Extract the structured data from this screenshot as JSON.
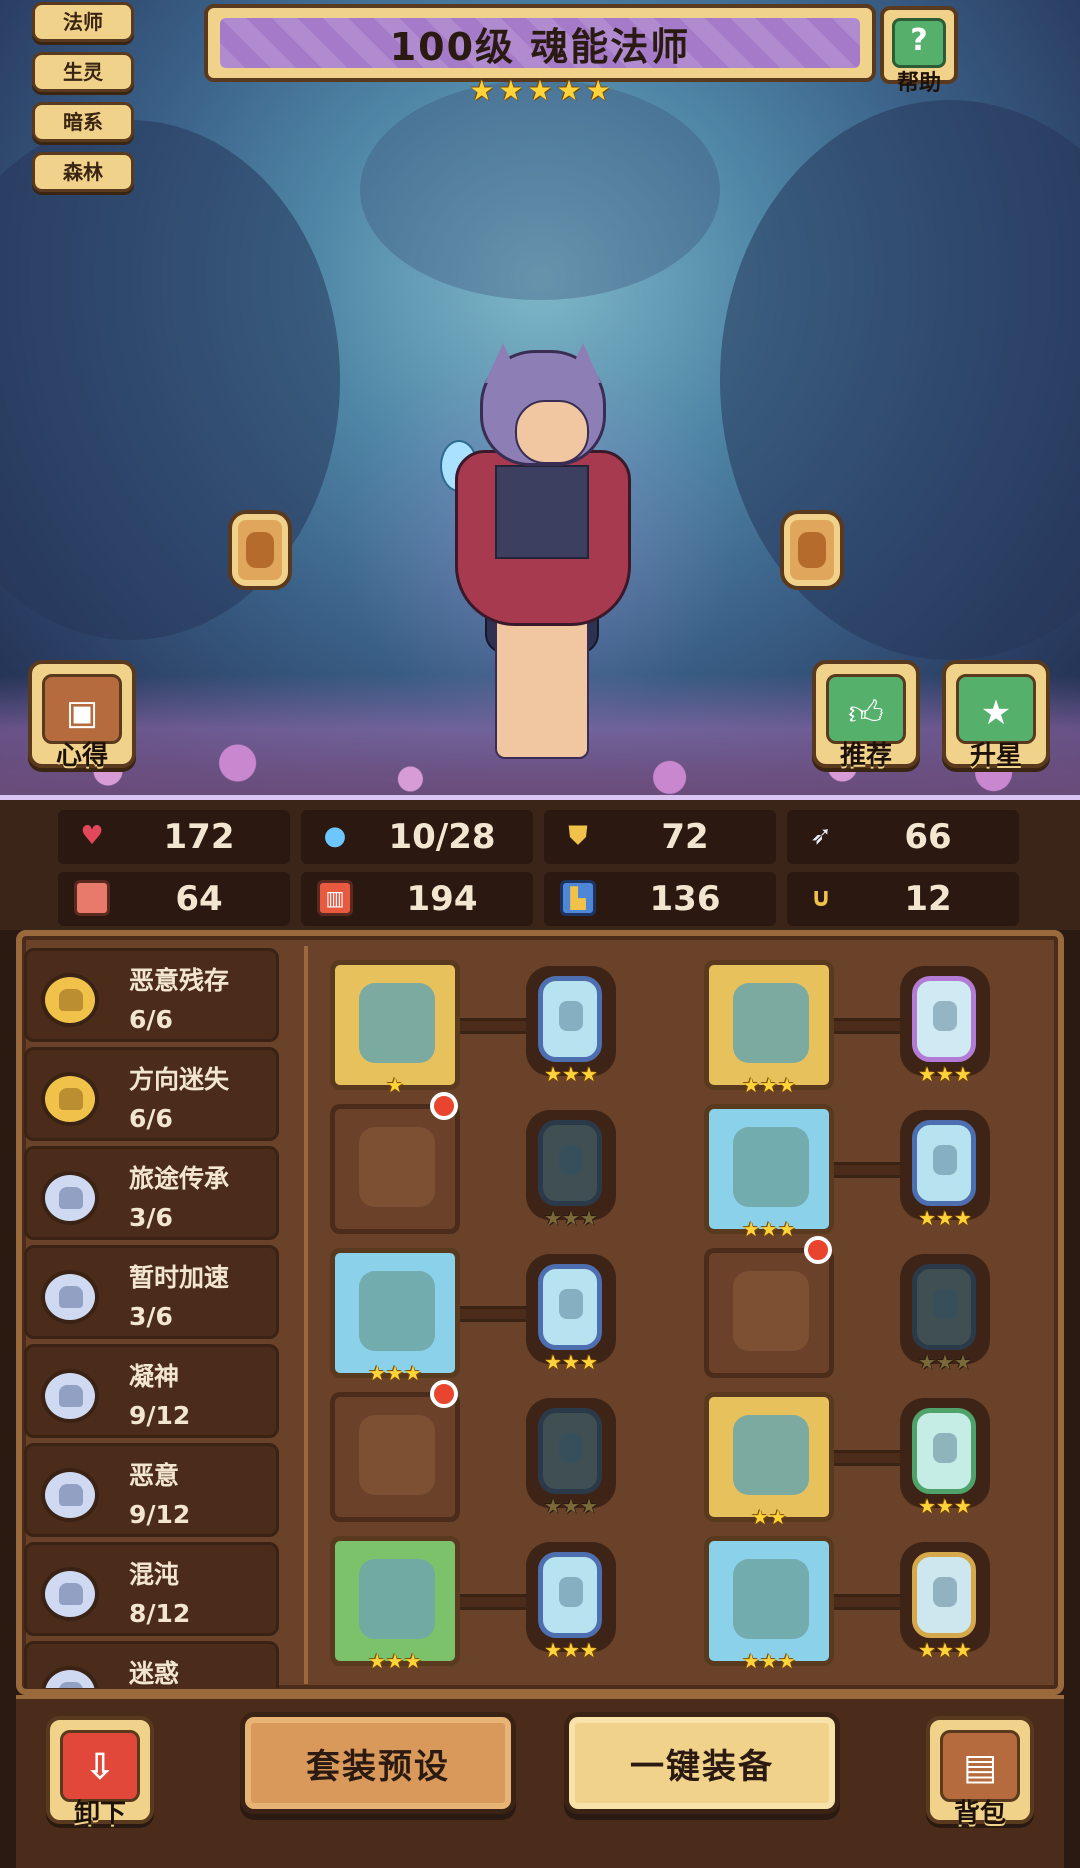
{
  "tags": [
    "法师",
    "生灵",
    "暗系",
    "森林"
  ],
  "title": {
    "text": "100级 魂能法师",
    "stars": 5
  },
  "help": {
    "icon": "question-icon",
    "label": "帮助"
  },
  "scene_buttons": {
    "left": {
      "icon": "book-icon",
      "label": "心得"
    },
    "recommend": {
      "icon": "thumbs-up-icon",
      "label": "推荐"
    },
    "upgrade": {
      "icon": "star-icon",
      "label": "升星"
    }
  },
  "stats": [
    {
      "icon": "heart-icon",
      "value": "172",
      "color": "#e2485a"
    },
    {
      "icon": "water-drop-icon",
      "value": "10/28",
      "color": "#6ec6ff"
    },
    {
      "icon": "shield-icon",
      "value": "72",
      "color": "#f0c24a"
    },
    {
      "icon": "wing-icon",
      "value": "66",
      "color": "#e8eef8"
    },
    {
      "icon": "fist-icon",
      "value": "64",
      "color": "#e77a6a"
    },
    {
      "icon": "spellbook-icon",
      "value": "194",
      "color": "#e85a3f"
    },
    {
      "icon": "boot-icon",
      "value": "136",
      "color": "#4e86d8"
    },
    {
      "icon": "horseshoe-icon",
      "value": "12",
      "color": "#f0c24a"
    }
  ],
  "sets": [
    {
      "name": "恶意残存",
      "count": "6/6",
      "tier": "gold"
    },
    {
      "name": "方向迷失",
      "count": "6/6",
      "tier": "gold"
    },
    {
      "name": "旅途传承",
      "count": "3/6",
      "tier": "silver"
    },
    {
      "name": "暂时加速",
      "count": "3/6",
      "tier": "silver"
    },
    {
      "name": "凝神",
      "count": "9/12",
      "tier": "silver"
    },
    {
      "name": "恶意",
      "count": "9/12",
      "tier": "silver"
    },
    {
      "name": "混沌",
      "count": "8/12",
      "tier": "silver"
    },
    {
      "name": "迷惑",
      "count": "",
      "tier": "silver"
    }
  ],
  "equipment": [
    {
      "slot": "weapon",
      "icon": "staff-icon",
      "bg": "gold",
      "stars": 1,
      "gem": "pale",
      "gem_stars": 3
    },
    {
      "slot": "helmet",
      "icon": "helmet-icon",
      "bg": "gold",
      "stars": 3,
      "gem": "pink",
      "gem_stars": 3
    },
    {
      "slot": "shield",
      "icon": "shield-icon",
      "bg": "empty",
      "stars": 0,
      "gem": "dim",
      "gem_stars": 3
    },
    {
      "slot": "armor",
      "icon": "dress-icon",
      "bg": "blue",
      "stars": 3,
      "gem": "pale",
      "gem_stars": 3
    },
    {
      "slot": "necklace",
      "icon": "necklace-icon",
      "bg": "blue",
      "stars": 3,
      "gem": "pale",
      "gem_stars": 3
    },
    {
      "slot": "gloves",
      "icon": "gloves-icon",
      "bg": "empty",
      "stars": 0,
      "gem": "dim",
      "gem_stars": 3
    },
    {
      "slot": "amulet",
      "icon": "amulet-icon",
      "bg": "empty",
      "stars": 0,
      "gem": "dim",
      "gem_stars": 3
    },
    {
      "slot": "belt",
      "icon": "belt-icon",
      "bg": "gold",
      "stars": 2,
      "gem": "green",
      "gem_stars": 3
    },
    {
      "slot": "ring",
      "icon": "ring-icon",
      "bg": "green",
      "stars": 3,
      "gem": "pale",
      "gem_stars": 3
    },
    {
      "slot": "boots",
      "icon": "boots-icon",
      "bg": "blue",
      "stars": 3,
      "gem": "gold",
      "gem_stars": 3
    }
  ],
  "bottom": {
    "unequip": {
      "icon": "arrow-down-icon",
      "label": "卸下"
    },
    "preset": "套装预设",
    "equip_all": "一键装备",
    "bag": {
      "icon": "backpack-icon",
      "label": "背包"
    }
  }
}
